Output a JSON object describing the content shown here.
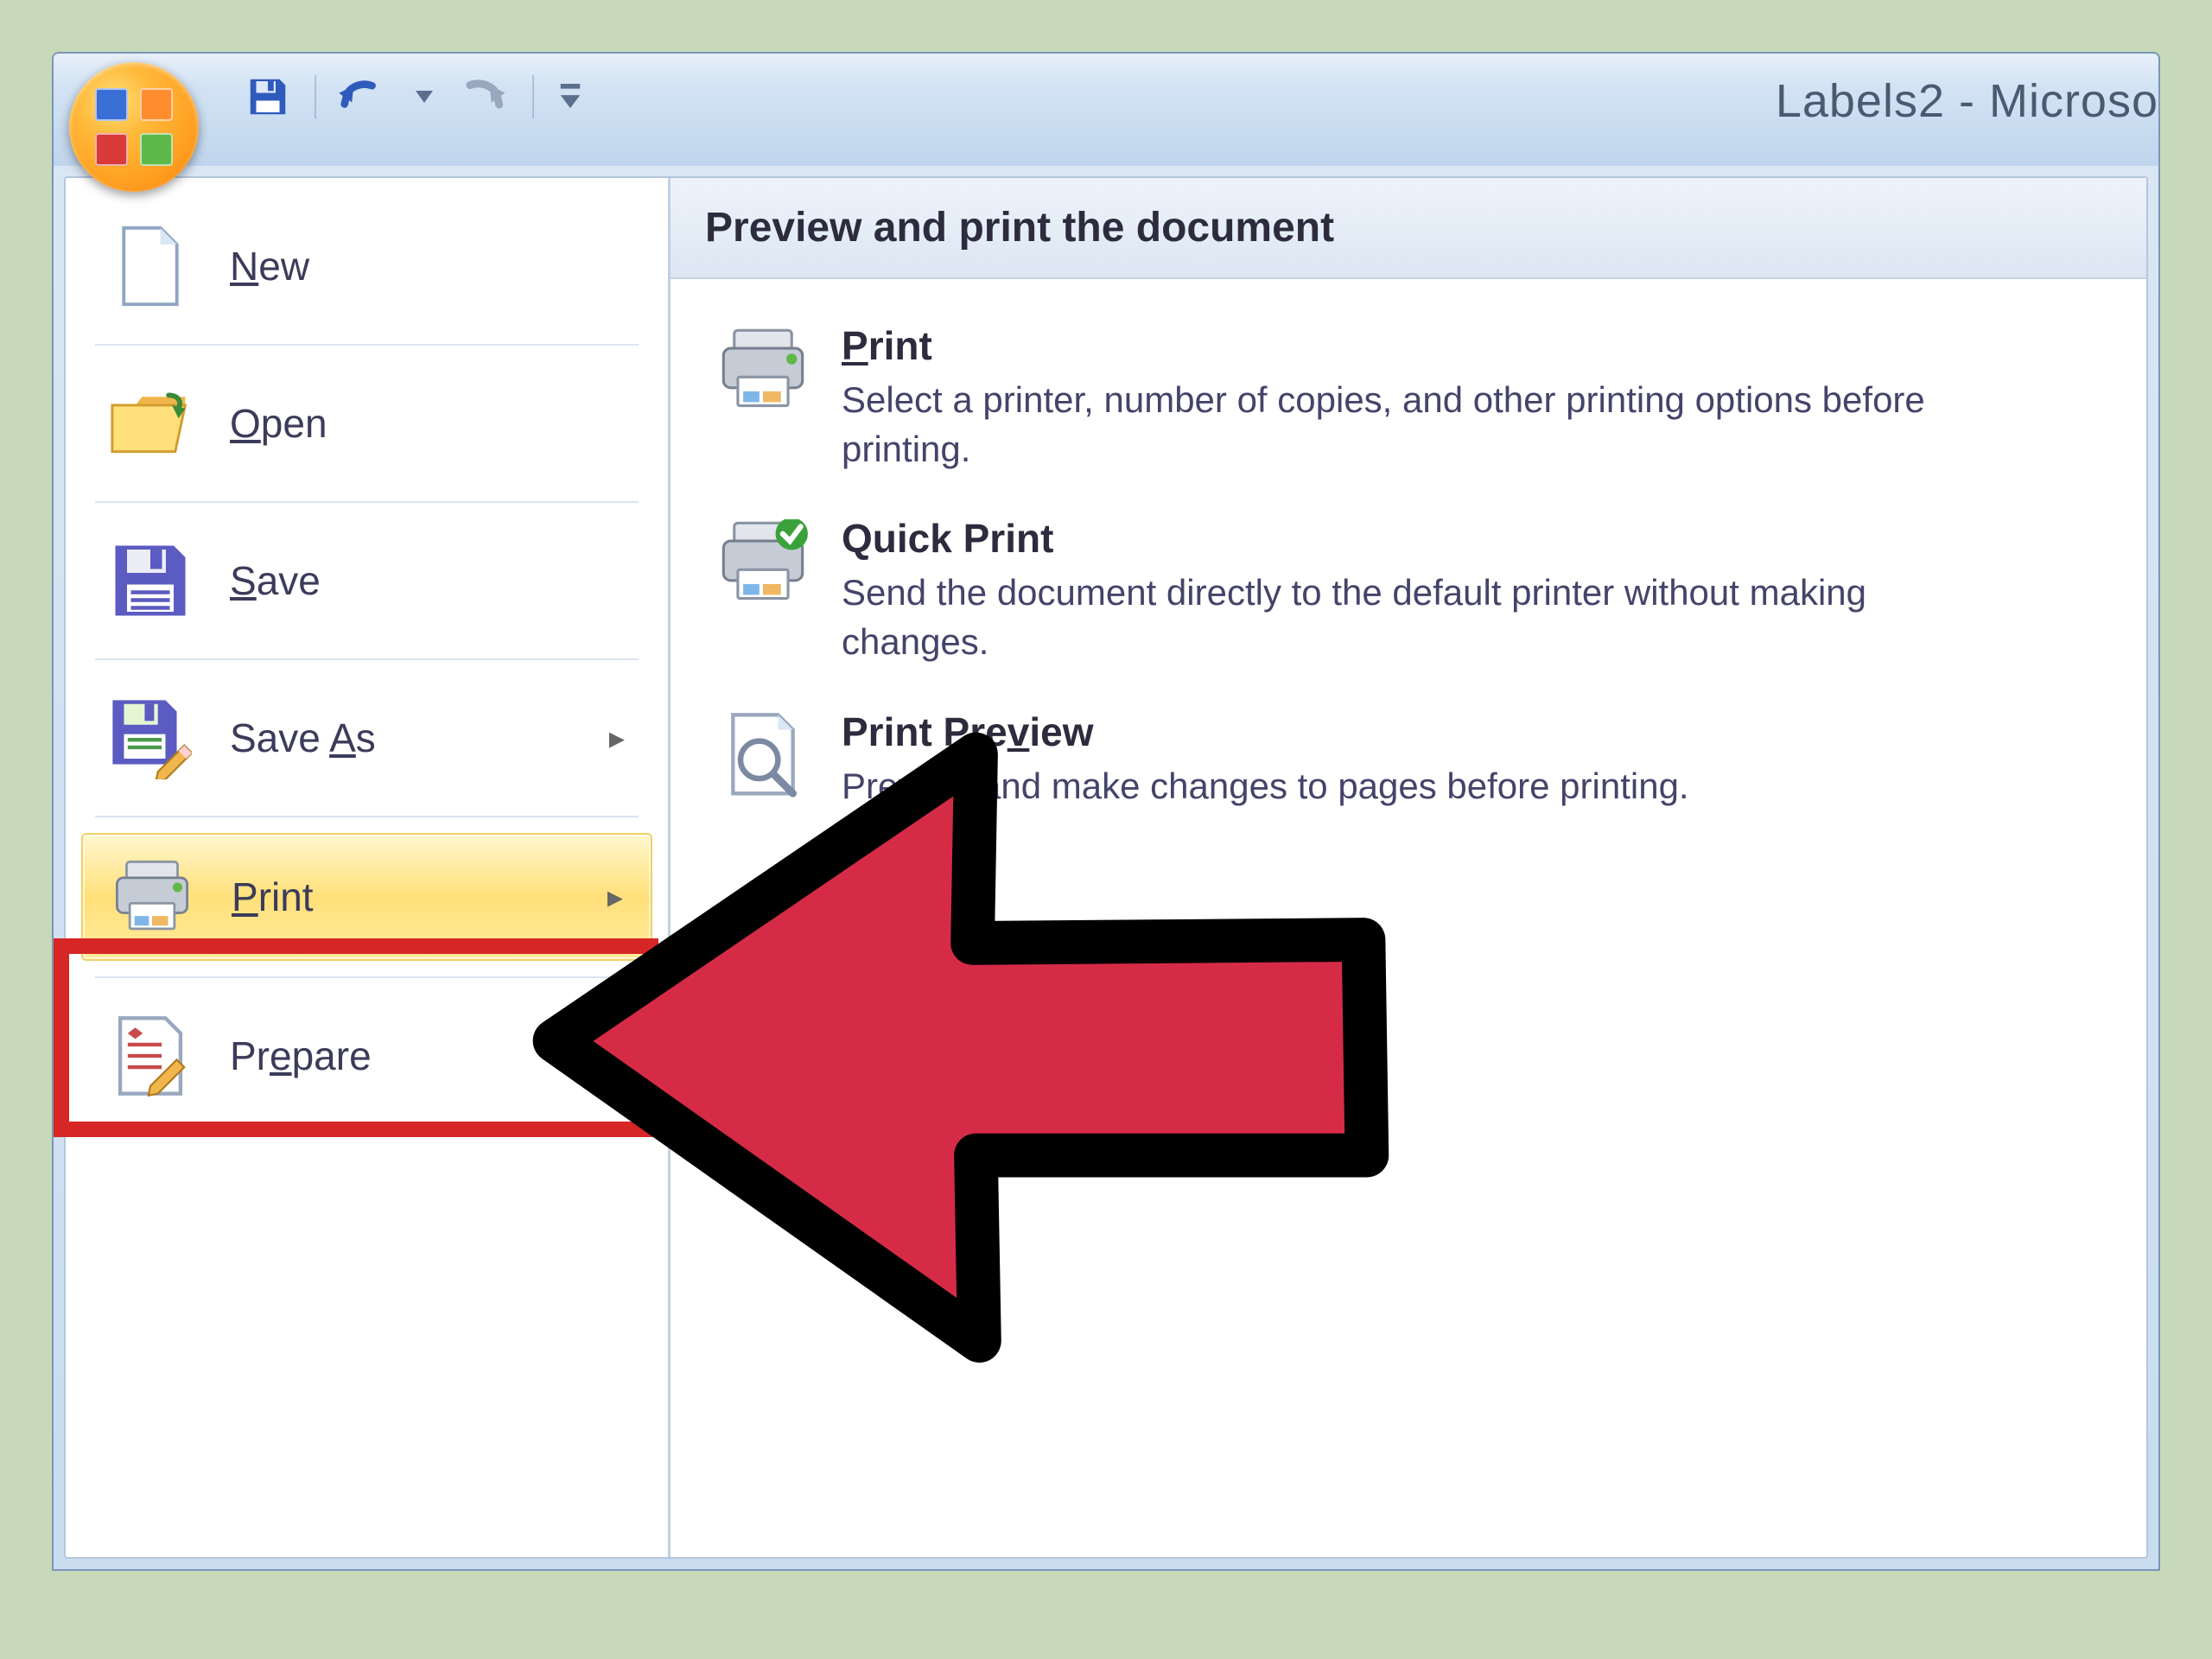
{
  "window": {
    "title_text": "Labels2 - Microso"
  },
  "qat": {
    "save_title": "Save",
    "undo_title": "Undo",
    "redo_title": "Redo",
    "customize_title": "Customize Quick Access Toolbar"
  },
  "office_menu": {
    "left_items": [
      {
        "key": "new",
        "label_html": "<u>N</u>ew",
        "icon": "new-document-icon",
        "has_submenu": false
      },
      {
        "key": "open",
        "label_html": "<u>O</u>pen",
        "icon": "folder-open-icon",
        "has_submenu": false
      },
      {
        "key": "save",
        "label_html": "<u>S</u>ave",
        "icon": "save-disk-icon",
        "has_submenu": false
      },
      {
        "key": "save-as",
        "label_html": "Save <u>A</u>s",
        "icon": "save-disk-pencil-icon",
        "has_submenu": true
      },
      {
        "key": "print",
        "label_html": "<u>P</u>rint",
        "icon": "printer-icon",
        "has_submenu": true,
        "highlighted": true
      },
      {
        "key": "prepare",
        "label_html": "Pr<u>e</u>pare",
        "icon": "prepare-icon",
        "has_submenu": true
      }
    ],
    "right_panel": {
      "heading": "Preview and print the document",
      "items": [
        {
          "key": "print",
          "icon": "printer-icon",
          "title_html": "<u>P</u>rint",
          "desc": "Select a printer, number of copies, and other printing options before printing."
        },
        {
          "key": "quick-print",
          "icon": "printer-check-icon",
          "title_html": "Quick Print",
          "desc": "Send the document directly to the default printer without making changes."
        },
        {
          "key": "print-preview",
          "icon": "print-preview-icon",
          "title_html": "Print Pre<u>v</u>iew",
          "desc": "Preview and make changes to pages before printing."
        }
      ]
    }
  }
}
